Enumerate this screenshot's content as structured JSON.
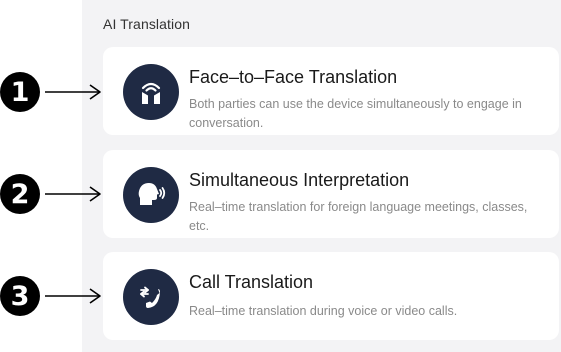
{
  "section": {
    "title": "AI Translation"
  },
  "markers": [
    "1",
    "2",
    "3"
  ],
  "cards": [
    {
      "title": "Face–to–Face Translation",
      "description": "Both parties can use the device simultaneously to engage in conversation.",
      "icon": "face-to-face-icon"
    },
    {
      "title": "Simultaneous Interpretation",
      "description": "Real–time translation for foreign language meetings, classes, etc.",
      "icon": "speaking-head-icon"
    },
    {
      "title": "Call Translation",
      "description": "Real–time translation during voice or video calls.",
      "icon": "phone-transfer-icon"
    }
  ],
  "colors": {
    "panel_background": "#f3f3f5",
    "card_background": "#ffffff",
    "icon_background": "#1f2a44",
    "marker": "#000000"
  }
}
